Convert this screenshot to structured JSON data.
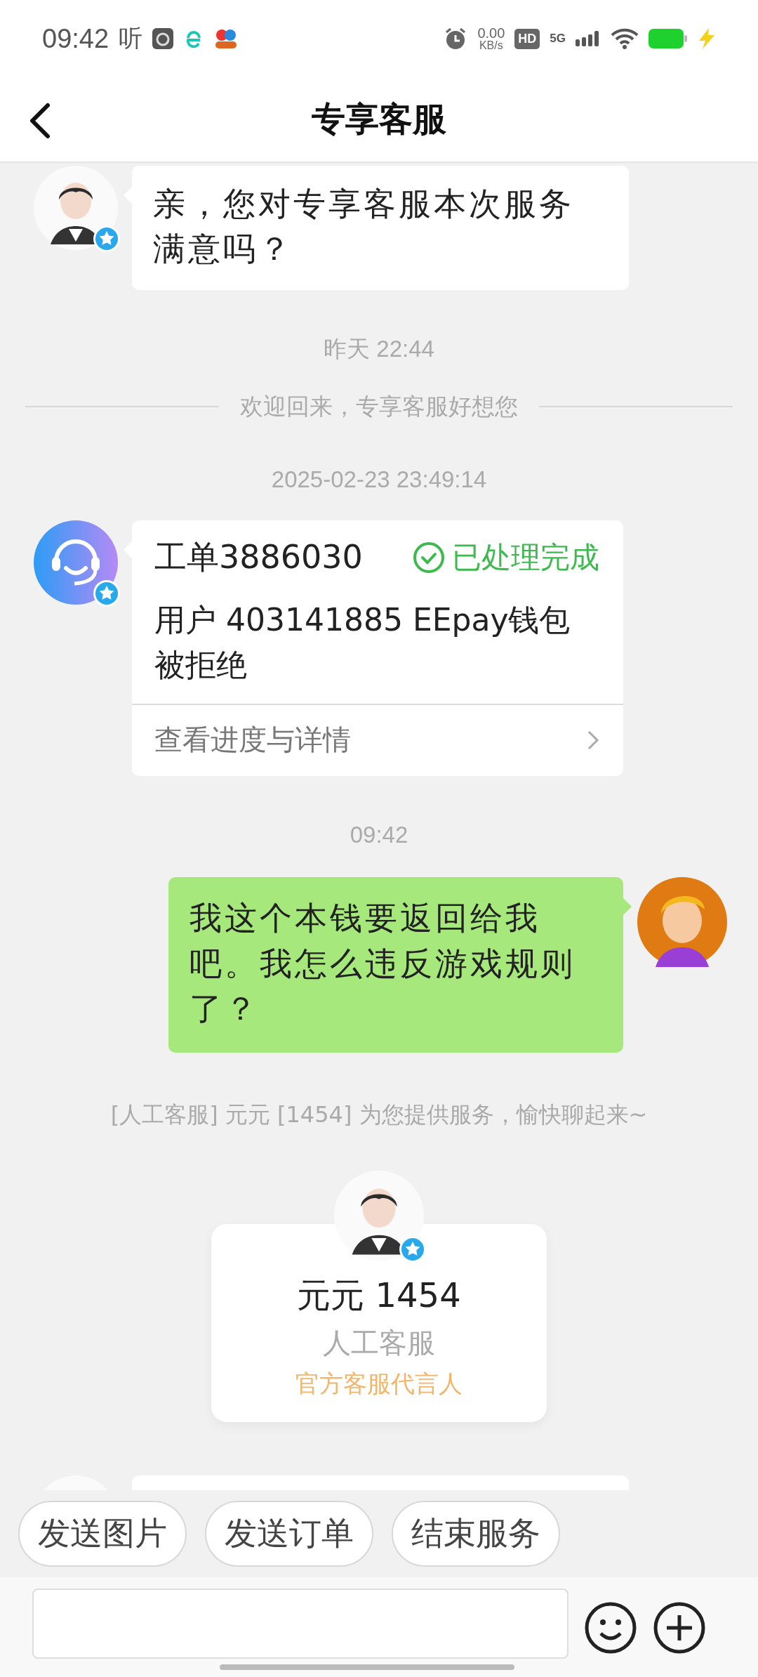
{
  "status_bar": {
    "time": "09:42",
    "app_label": "听",
    "net_speed": "0.00",
    "net_unit": "KB/s",
    "hd": "HD",
    "network": "5G"
  },
  "header": {
    "title": "专享客服"
  },
  "messages": [
    {
      "kind": "agent_text",
      "text": "亲，您对专享客服本次服务满意吗？"
    },
    {
      "kind": "time",
      "text": "昨天 22:44"
    },
    {
      "kind": "divider",
      "text": "欢迎回来，专享客服好想您"
    },
    {
      "kind": "time",
      "text": "2025-02-23 23:49:14"
    },
    {
      "kind": "ticket",
      "title": "工单3886030",
      "status": "已处理完成",
      "body": "用户 403141885 EEpay钱包被拒绝",
      "link": "查看进度与详情"
    },
    {
      "kind": "time",
      "text": "09:42"
    },
    {
      "kind": "user_text",
      "text": "我这个本钱要返回给我吧。我怎么违反游戏规则了？"
    },
    {
      "kind": "notice",
      "text": "[人工客服] 元元 [1454] 为您提供服务，愉快聊起来~"
    },
    {
      "kind": "agent_card",
      "name": "元元 1454",
      "role": "人工客服",
      "tagline": "官方客服代言人"
    },
    {
      "kind": "agent_partial"
    }
  ],
  "quick_actions": [
    "发送图片",
    "发送订单",
    "结束服务"
  ]
}
